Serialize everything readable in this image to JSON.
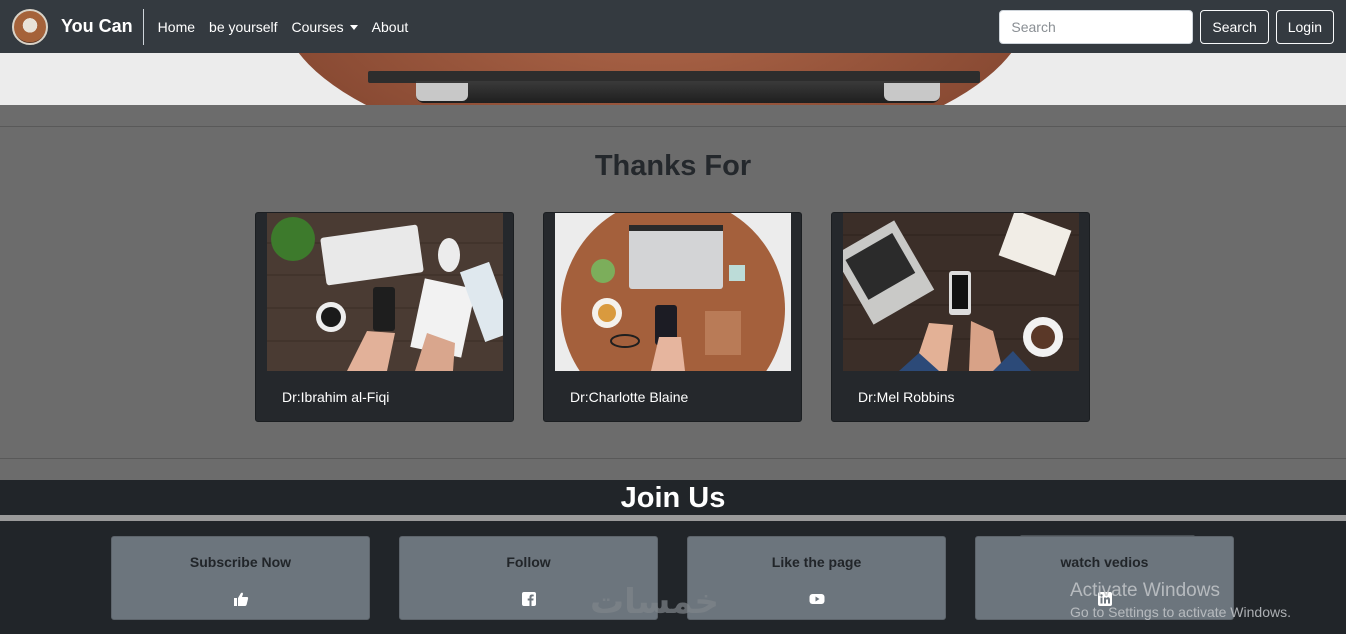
{
  "navbar": {
    "brand": "You Can",
    "links": [
      "Home",
      "be yourself",
      "Courses",
      "About"
    ],
    "search_placeholder": "Search",
    "search_button": "Search",
    "login_button": "Login"
  },
  "thanks": {
    "title": "Thanks For",
    "cards": [
      {
        "name": "Dr:Ibrahim al-Fiqi"
      },
      {
        "name": "Dr:Charlotte Blaine"
      },
      {
        "name": "Dr:Mel Robbins"
      }
    ]
  },
  "join": {
    "title": "Join Us",
    "cards": [
      {
        "label": "Subscribe Now",
        "icon": "thumbs-up-icon"
      },
      {
        "label": "Follow",
        "icon": "facebook-icon"
      },
      {
        "label": "Like the page",
        "icon": "youtube-icon"
      },
      {
        "label": "watch vedios",
        "icon": "linkedin-icon"
      }
    ]
  },
  "overlay": {
    "activate_title": "Activate Windows",
    "activate_sub": "Go to Settings to activate Windows.",
    "watermark": "خمسات"
  },
  "colors": {
    "navbar": "#343a40",
    "page_bg": "#6c6c6c",
    "card_bg": "#25282c",
    "join_bg": "#212529",
    "join_card": "#6c757d"
  }
}
